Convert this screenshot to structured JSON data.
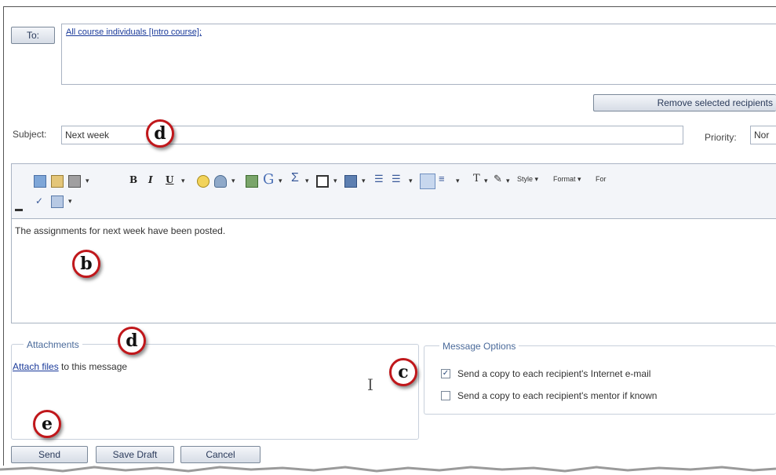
{
  "to": {
    "button_label": "To:",
    "recipients_text": "All course individuals [Intro course];"
  },
  "remove_button_label": "Remove selected recipients",
  "subject": {
    "label": "Subject:",
    "value": "Next week"
  },
  "priority": {
    "label": "Priority:",
    "value": "Nor"
  },
  "toolbar": {
    "style_label": "Style",
    "format_label": "Format",
    "font_label": "For"
  },
  "editor": {
    "body_text": "The assignments for next week have been posted."
  },
  "attachments": {
    "legend": "Attachments",
    "link_text": "Attach files",
    "suffix_text": " to this message"
  },
  "message_options": {
    "legend": "Message Options",
    "option1_label": "Send a copy to each recipient's Internet e-mail",
    "option1_checked": true,
    "option2_label": "Send a copy to each recipient's mentor if known",
    "option2_checked": false
  },
  "actions": {
    "send_label": "Send",
    "save_draft_label": "Save Draft",
    "cancel_label": "Cancel"
  },
  "markers": {
    "subject_marker": "d",
    "editor_marker": "b",
    "attachments_marker": "d",
    "options_marker": "c",
    "send_marker": "e"
  },
  "colors": {
    "marker_border": "#c0171b",
    "link": "#1a3a9a",
    "legend": "#4a6a9a"
  }
}
